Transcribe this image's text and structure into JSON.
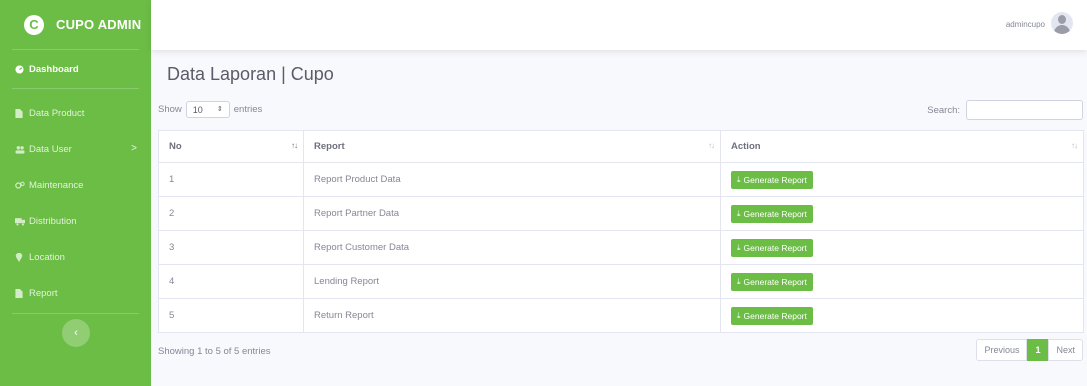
{
  "brand": {
    "logo_letter": "C",
    "name": "CUPO ADMIN"
  },
  "sidebar": {
    "items": [
      {
        "label": "Dashboard",
        "icon": "dashboard-icon"
      },
      {
        "label": "Data Product",
        "icon": "file-icon"
      },
      {
        "label": "Data User",
        "icon": "users-icon"
      },
      {
        "label": "Maintenance",
        "icon": "gears-icon"
      },
      {
        "label": "Distribution",
        "icon": "truck-icon"
      },
      {
        "label": "Location",
        "icon": "map-marker-icon"
      },
      {
        "label": "Report",
        "icon": "file-icon"
      }
    ],
    "toggle_glyph": "‹"
  },
  "topbar": {
    "username": "admincupo"
  },
  "page": {
    "title": "Data Laporan | Cupo"
  },
  "controls": {
    "show_label": "Show",
    "entries_value": "10",
    "entries_label": "entries",
    "search_label": "Search:"
  },
  "table": {
    "headers": [
      "No",
      "Report",
      "Action"
    ],
    "rows": [
      {
        "no": "1",
        "report": "Report Product Data"
      },
      {
        "no": "2",
        "report": "Report Partner Data"
      },
      {
        "no": "3",
        "report": "Report Customer Data"
      },
      {
        "no": "4",
        "report": "Lending Report"
      },
      {
        "no": "5",
        "report": "Return Report"
      }
    ],
    "action_label": "Generate Report"
  },
  "footer": {
    "info": "Showing 1 to 5 of 5 entries",
    "prev": "Previous",
    "page": "1",
    "next": "Next"
  },
  "colors": {
    "accent": "#6cbd45",
    "bg": "#f8f9fc",
    "text": "#858796"
  }
}
